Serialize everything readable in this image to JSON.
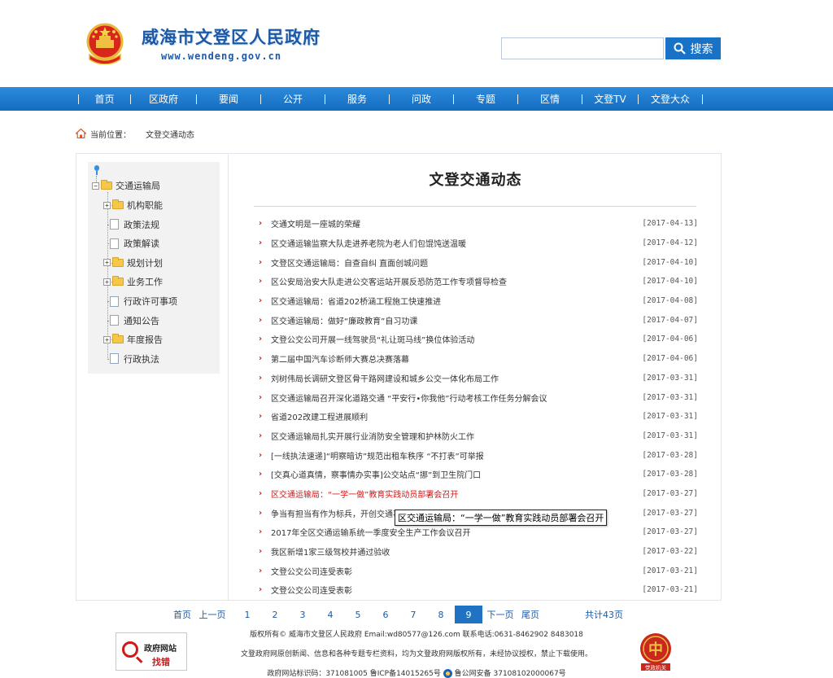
{
  "header": {
    "site_title": "威海市文登区人民政府",
    "site_url": "www.wendeng.gov.cn",
    "search_placeholder": "",
    "search_button": "搜索"
  },
  "nav": [
    "首页",
    "区政府",
    "要闻",
    "公开",
    "服务",
    "问政",
    "专题",
    "区情",
    "文登TV",
    "文登大众"
  ],
  "breadcrumb": {
    "label": "当前位置：",
    "current": "文登交通动态"
  },
  "sidebar": {
    "root": "交通运输局",
    "items": [
      {
        "label": "机构职能",
        "type": "folder"
      },
      {
        "label": "政策法规",
        "type": "doc"
      },
      {
        "label": "政策解读",
        "type": "doc"
      },
      {
        "label": "规划计划",
        "type": "folder"
      },
      {
        "label": "业务工作",
        "type": "folder"
      },
      {
        "label": "行政许可事项",
        "type": "doc"
      },
      {
        "label": "通知公告",
        "type": "doc"
      },
      {
        "label": "年度报告",
        "type": "folder"
      },
      {
        "label": "行政执法",
        "type": "doc"
      }
    ]
  },
  "main": {
    "title": "文登交通动态",
    "news": [
      {
        "title": "交通文明是一座城的荣耀",
        "date": "[2017-04-13]"
      },
      {
        "title": "区交通运输监察大队走进养老院为老人们包馄饨送温暖",
        "date": "[2017-04-12]"
      },
      {
        "title": "文登区交通运输局：自查自纠 直面创城问题",
        "date": "[2017-04-10]"
      },
      {
        "title": "区公安局治安大队走进公交客运站开展反恐防范工作专项督导检查",
        "date": "[2017-04-10]"
      },
      {
        "title": "区交通运输局：省道202桥涵工程施工快速推进",
        "date": "[2017-04-08]"
      },
      {
        "title": "区交通运输局：做好“廉政教育”自习功课",
        "date": "[2017-04-07]"
      },
      {
        "title": "文登公交公司开展一线驾驶员“礼让斑马线”换位体验活动",
        "date": "[2017-04-06]"
      },
      {
        "title": "第二届中国汽车诊断师大赛总决赛落幕",
        "date": "[2017-04-06]"
      },
      {
        "title": "刘树伟局长调研文登区骨干路网建设和城乡公交一体化布局工作",
        "date": "[2017-03-31]"
      },
      {
        "title": "区交通运输局召开深化道路交通 “平安行•你我他”行动考核工作任务分解会议",
        "date": "[2017-03-31]"
      },
      {
        "title": "省道202改建工程进展顺利",
        "date": "[2017-03-31]"
      },
      {
        "title": "区交通运输局扎实开展行业消防安全管理和护林防火工作",
        "date": "[2017-03-31]"
      },
      {
        "title": "[一线执法速递]“明察暗访”规范出租车秩序 “不打表”可举报",
        "date": "[2017-03-28]"
      },
      {
        "title": "[交真心道真情，察事情办实事]公交站点“挪”到卫生院门口",
        "date": "[2017-03-28]"
      },
      {
        "title": "区交通运输局：“一学一做”教育实践动员部署会召开",
        "date": "[2017-03-27]",
        "hot": true
      },
      {
        "title": "争当有担当有作为标兵，开创交通事业新篇章",
        "date": "[2017-03-27]"
      },
      {
        "title": "2017年全区交通运输系统一季度安全生产工作会议召开",
        "date": "[2017-03-27]"
      },
      {
        "title": "我区新增1家三级驾校并通过验收",
        "date": "[2017-03-22]"
      },
      {
        "title": "文登公交公司连受表彰",
        "date": "[2017-03-21]"
      },
      {
        "title": "文登公交公司连受表彰",
        "date": "[2017-03-21]"
      }
    ],
    "tooltip": "区交通运输局：“一学一做”教育实践动员部署会召开"
  },
  "pagination": {
    "first": "首页",
    "prev": "上一页",
    "pages": [
      "1",
      "2",
      "3",
      "4",
      "5",
      "6",
      "7",
      "8",
      "9"
    ],
    "current": "9",
    "next": "下一页",
    "last": "尾页",
    "total": "共计43页"
  },
  "footer": {
    "line1": "版权所有© 威海市文登区人民政府 Email:wd80577@126.com 联系电话:0631-8462902 8483018",
    "line2": "文登政府网原创新闻、信息和各种专题专栏资料，均为文登政府网版权所有，未经协议授权，禁止下载使用。",
    "line3_a": "政府网站标识码：371081005  鲁ICP备14015265号",
    "line3_b": "鲁公网安备 37108102000067号",
    "badge_line1": "政府网站",
    "badge_line2": "找错",
    "party_badge": "党政机关"
  },
  "colors": {
    "brand_blue": "#1c5aa8",
    "nav_blue": "#1f78cf",
    "accent_red": "#d21818"
  }
}
